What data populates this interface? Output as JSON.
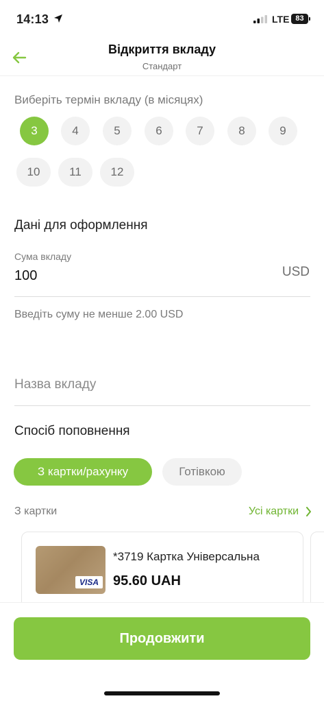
{
  "status_bar": {
    "time": "14:13",
    "network": "LTE",
    "battery": "83",
    "icons": [
      "location-arrow-icon",
      "signal-bars-icon",
      "battery-icon"
    ]
  },
  "header": {
    "title": "Відкриття вкладу",
    "subtitle": "Стандарт",
    "back_icon": "arrow-left-icon"
  },
  "term": {
    "label": "Виберіть термін вкладу (в місяцях)",
    "selected": "3",
    "options": [
      "3",
      "4",
      "5",
      "6",
      "7",
      "8",
      "9",
      "10",
      "11",
      "12"
    ]
  },
  "form": {
    "title": "Дані для оформлення",
    "amount_label": "Сума вкладу",
    "amount_value": "100",
    "currency": "USD",
    "hint": "Введіть суму не менше 2.00  USD",
    "name_placeholder": "Назва вкладу"
  },
  "funding": {
    "title": "Спосіб поповнення",
    "methods": [
      "З картки/рахунку",
      "Готівкою"
    ],
    "selected_method": "З картки/рахунку",
    "from_card_label": "З картки",
    "all_cards_link": "Усі картки"
  },
  "card": {
    "name": "*3719 Картка Універсальна",
    "balance": "95.60 UAH",
    "brand": "VISA"
  },
  "actions": {
    "continue_label": "Продовжити"
  },
  "colors": {
    "accent": "#86c741",
    "link": "#6fb431",
    "chip_bg": "#f2f2f2"
  }
}
